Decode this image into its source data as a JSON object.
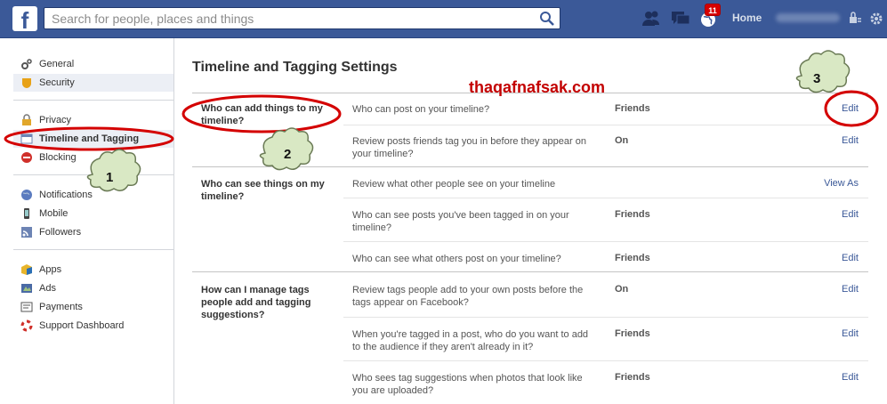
{
  "topbar": {
    "logo": "f",
    "search_placeholder": "Search for people, places and things",
    "notification_count": "11",
    "home_label": "Home"
  },
  "sidebar": {
    "group1": [
      {
        "label": "General",
        "icon": "gears-icon"
      },
      {
        "label": "Security",
        "icon": "security-badge-icon"
      }
    ],
    "group2": [
      {
        "label": "Privacy",
        "icon": "lock-icon"
      },
      {
        "label": "Timeline and Tagging",
        "icon": "timeline-icon"
      },
      {
        "label": "Blocking",
        "icon": "blocking-icon"
      }
    ],
    "group3": [
      {
        "label": "Notifications",
        "icon": "globe-icon"
      },
      {
        "label": "Mobile",
        "icon": "mobile-icon"
      },
      {
        "label": "Followers",
        "icon": "rss-icon"
      }
    ],
    "group4": [
      {
        "label": "Apps",
        "icon": "apps-cube-icon"
      },
      {
        "label": "Ads",
        "icon": "ads-icon"
      },
      {
        "label": "Payments",
        "icon": "payments-icon"
      },
      {
        "label": "Support Dashboard",
        "icon": "lifebuoy-icon"
      }
    ]
  },
  "main": {
    "title": "Timeline and Tagging Settings",
    "sections": [
      {
        "title": "Who can add things to my timeline?",
        "rows": [
          {
            "question": "Who can post on your timeline?",
            "value": "Friends",
            "action": "Edit"
          },
          {
            "question": "Review posts friends tag you in before they appear on your timeline?",
            "value": "On",
            "action": "Edit"
          }
        ]
      },
      {
        "title": "Who can see things on my timeline?",
        "rows": [
          {
            "question": "Review what other people see on your timeline",
            "value": "",
            "action": "View As"
          },
          {
            "question": "Who can see posts you've been tagged in on your timeline?",
            "value": "Friends",
            "action": "Edit"
          },
          {
            "question": "Who can see what others post on your timeline?",
            "value": "Friends",
            "action": "Edit"
          }
        ]
      },
      {
        "title": "How can I manage tags people add and tagging suggestions?",
        "rows": [
          {
            "question": "Review tags people add to your own posts before the tags appear on Facebook?",
            "value": "On",
            "action": "Edit"
          },
          {
            "question": "When you're tagged in a post, who do you want to add to the audience if they aren't already in it?",
            "value": "Friends",
            "action": "Edit"
          },
          {
            "question": "Who sees tag suggestions when photos that look like you are uploaded?",
            "value": "Friends",
            "action": "Edit"
          }
        ]
      }
    ]
  },
  "annotations": {
    "watermark": "thaqafnafsak.com",
    "callouts": [
      "1",
      "2",
      "3"
    ],
    "highlight_color": "#d40000",
    "cloud_color": "#d9e8c4"
  },
  "colors": {
    "brand": "#3b5998",
    "link": "#3b5998",
    "active_bg": "#eceff5"
  }
}
